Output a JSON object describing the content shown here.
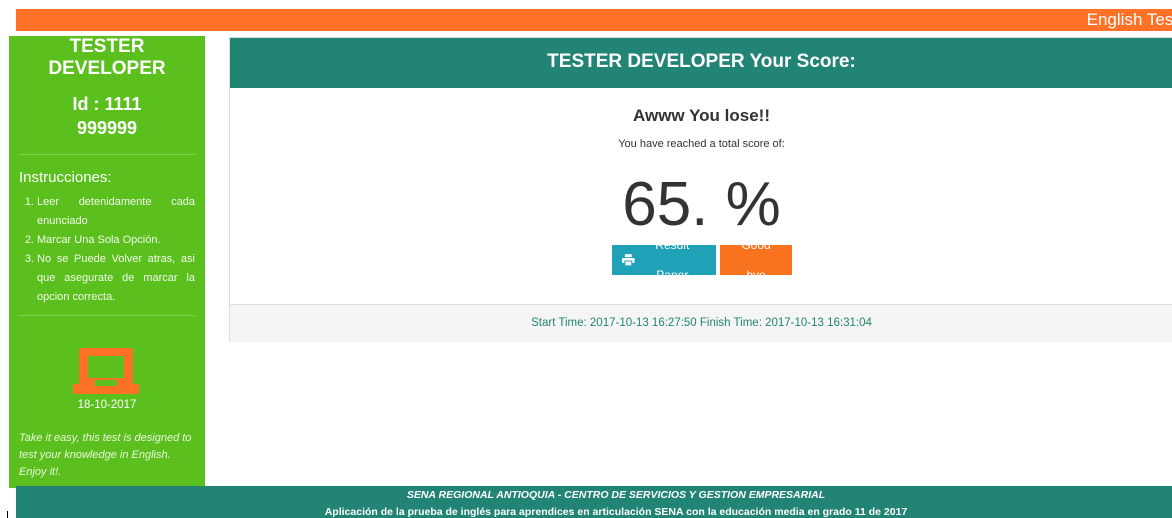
{
  "topbar": {
    "brand": "English Test"
  },
  "sidebar": {
    "name": "TESTER DEVELOPER",
    "id_label": "Id : 1111",
    "id_value": "999999",
    "instructions_title": "Instrucciones:",
    "instructions": [
      {
        "num": "1.",
        "text": "Leer detenidamente cada enunciado"
      },
      {
        "num": "2.",
        "text": "Marcar Una Sola Opción."
      },
      {
        "num": "3.",
        "text": "No se Puede Volver atras, asi que asegurate de marcar la opcion correcta."
      }
    ],
    "monitor_icon": "monitor-icon",
    "date": "18-10-2017",
    "note": "Take it easy, this test is designed to test your knowledge in English. Enjoy it!."
  },
  "panel": {
    "title": "TESTER DEVELOPER Your Score:",
    "result_message": "Awww You lose!!",
    "reached_text": "You have reached a total score of:",
    "score": "65. %",
    "result_button": {
      "icon": "print-icon",
      "label": "Result Paper"
    },
    "bye_button": {
      "label": "Good bye"
    },
    "times": "Start Time: 2017-10-13 16:27:50 Finish Time: 2017-10-13 16:31:04"
  },
  "footer": {
    "line1": "SENA REGIONAL ANTIOQUIA - CENTRO DE SERVICIOS Y GESTION EMPRESARIAL",
    "line2": "Aplicación de la prueba de inglés para aprendices en articulación SENA con la educación media en grado 11 de 2017"
  },
  "colors": {
    "orange": "#ff7127",
    "green": "#5bc01d",
    "teal": "#218475",
    "info": "#1fa1b8"
  }
}
